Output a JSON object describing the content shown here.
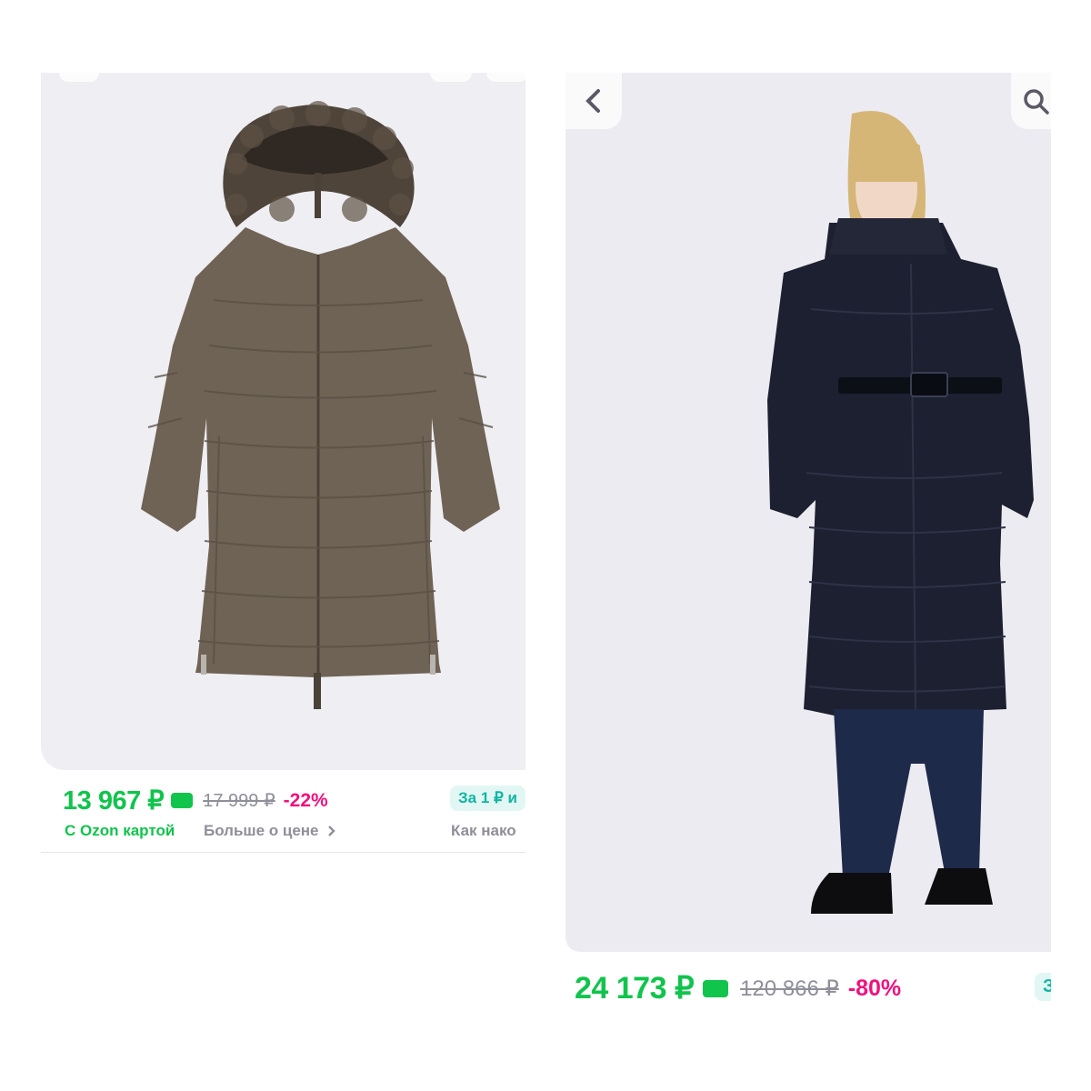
{
  "left_card": {
    "price": "13 967 ₽",
    "old_price": "17 999 ₽",
    "discount": "-22%",
    "promo": "За 1 ₽ и",
    "ozon_card_label": "С Ozon картой",
    "more_about_price": "Больше о цене",
    "how_to_save": "Как нако",
    "chevron_icon": "chevron-right-icon",
    "colors": {
      "accent_green": "#10c44c",
      "discount_pink": "#f1117e",
      "promo_teal": "#10b6a3"
    }
  },
  "right_card": {
    "price": "24 173 ₽",
    "old_price": "120 866 ₽",
    "discount": "-80%",
    "promo": "З",
    "back_icon": "chevron-left-icon",
    "search_icon": "search-icon"
  }
}
